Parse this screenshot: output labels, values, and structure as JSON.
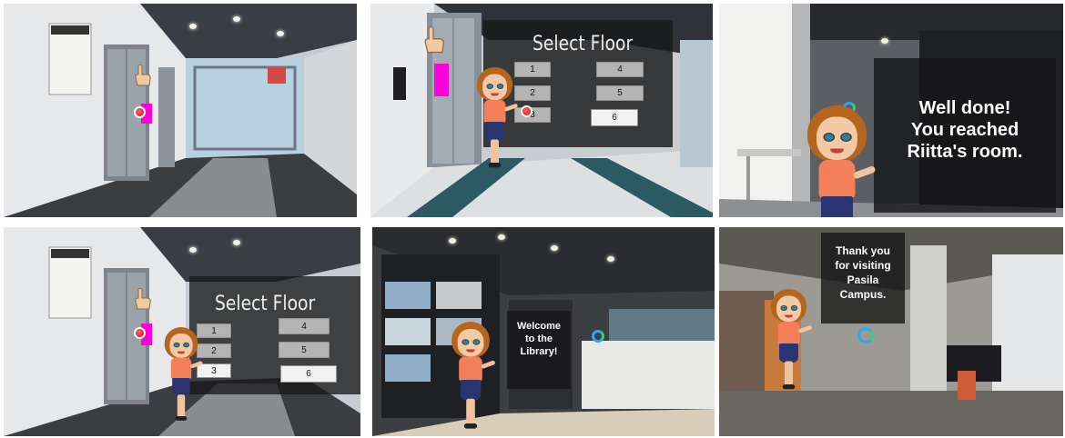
{
  "panels": [
    {
      "id": "lobby-lift-call"
    },
    {
      "id": "select-floor-near",
      "floor_menu": {
        "title": "Select Floor",
        "buttons": [
          "1",
          "2",
          "3",
          "4",
          "5",
          "6"
        ]
      }
    },
    {
      "id": "riitta-room",
      "message_lines": [
        "Well done!",
        "You reached",
        "Riitta's room."
      ]
    },
    {
      "id": "select-floor-lobby",
      "floor_menu": {
        "title": "Select Floor",
        "buttons": [
          "1",
          "2",
          "3",
          "4",
          "5",
          "6"
        ]
      }
    },
    {
      "id": "library",
      "message_lines": [
        "Welcome",
        "to the",
        "Library!"
      ]
    },
    {
      "id": "farewell",
      "message_lines": [
        "Thank you",
        "for visiting",
        "Pasila",
        "Campus."
      ]
    }
  ],
  "icons": {
    "pointer": "pointing-hand-icon",
    "hotspot": "red-dot-hotspot-icon",
    "nav_ring": "ring-navigation-icon",
    "marker": "pink-marker-icon"
  },
  "colors": {
    "marker": "#ff00d8",
    "hotspot": "#d40000",
    "ring": "#2aa8f0",
    "overlay": "#141416"
  }
}
